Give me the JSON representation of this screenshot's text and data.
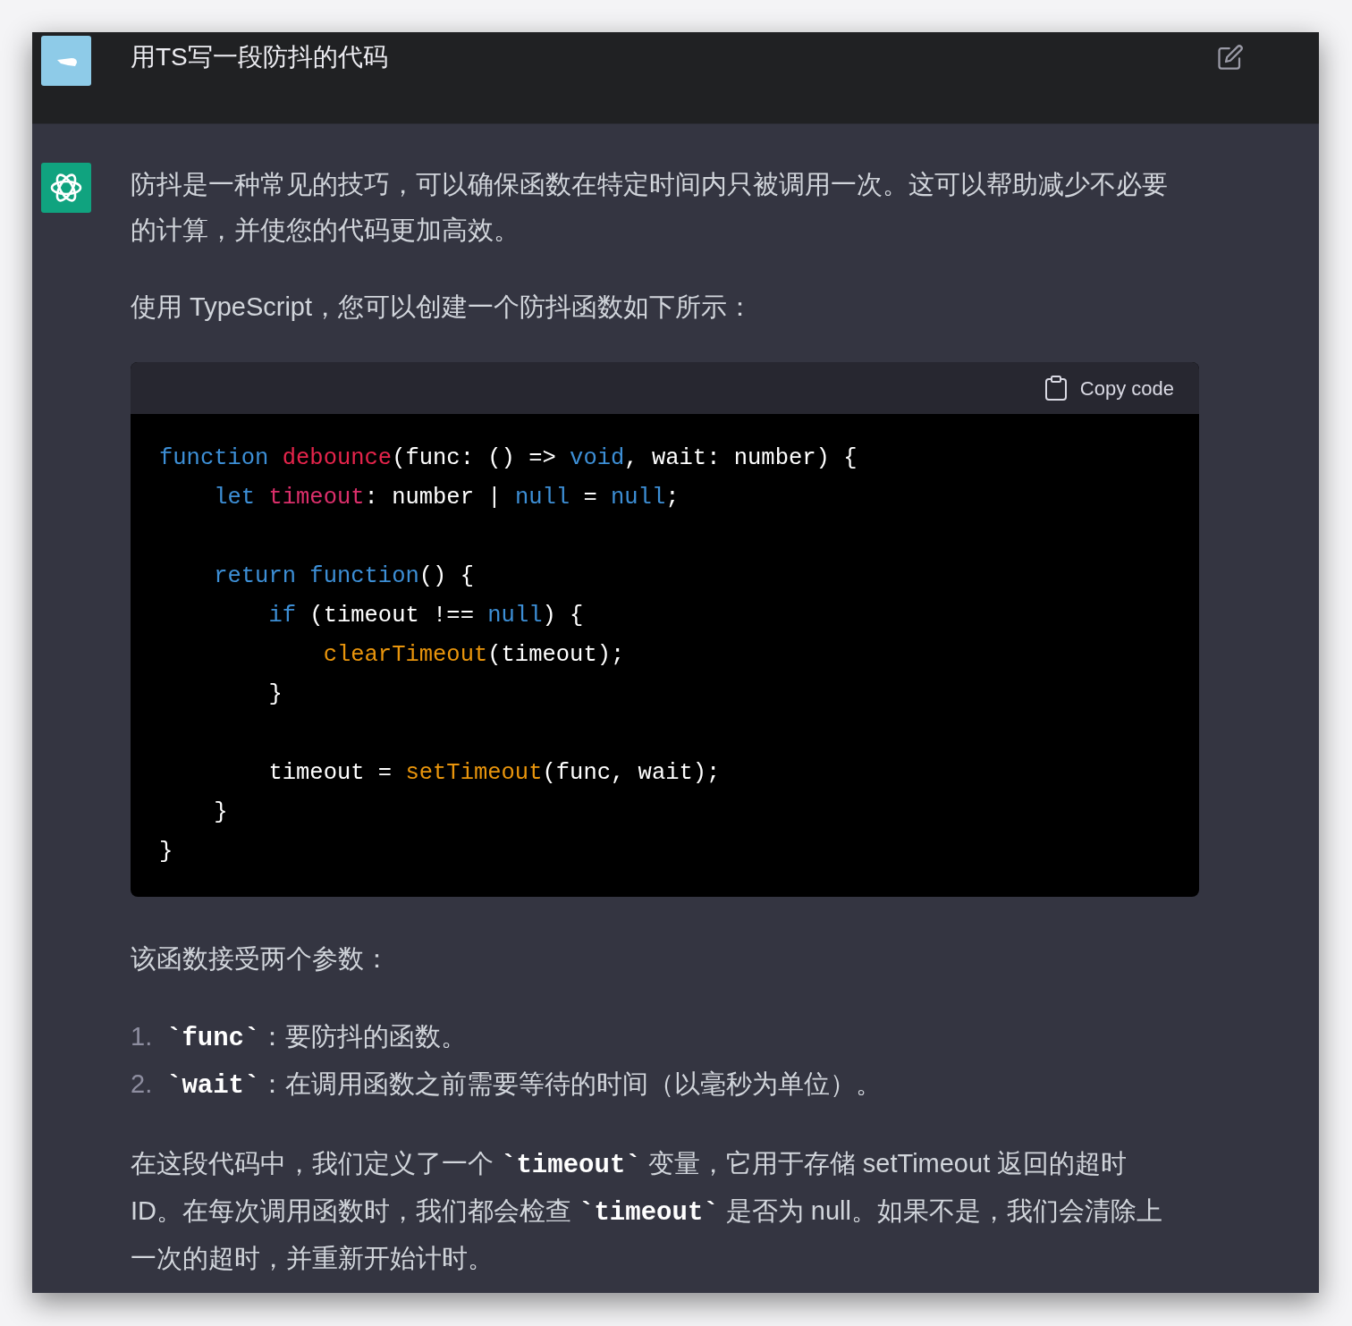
{
  "question": {
    "text": "用TS写一段防抖的代码"
  },
  "answer": {
    "intro": [
      {
        "segments": [
          {
            "kind": "text",
            "text": "防抖是一种常见的技巧，可以确保函数在特定时间内只被调用一次。这可以帮助减少不必要的计算，并使您的代码更加高效。"
          }
        ]
      },
      {
        "segments": [
          {
            "kind": "text",
            "text": "使用 TypeScript，您可以创建一个防抖函数如下所示："
          }
        ]
      }
    ],
    "code_block": {
      "copy_label": "Copy code",
      "lines": [
        {
          "kind": "code",
          "tokens": [
            {
              "kind": "keyword",
              "text": "function "
            },
            {
              "kind": "name",
              "text": "debounce"
            },
            {
              "kind": "plain",
              "text": "(func: () => "
            },
            {
              "kind": "keyword",
              "text": "void"
            },
            {
              "kind": "plain",
              "text": ", wait: number) {"
            }
          ]
        },
        {
          "kind": "code",
          "tokens": [
            {
              "kind": "keyword",
              "text": "    let "
            },
            {
              "kind": "variable",
              "text": "timeout"
            },
            {
              "kind": "plain",
              "text": ": number | "
            },
            {
              "kind": "keyword",
              "text": "null"
            },
            {
              "kind": "plain",
              "text": " = "
            },
            {
              "kind": "keyword",
              "text": "null"
            },
            {
              "kind": "plain",
              "text": ";"
            }
          ]
        },
        {
          "kind": "blank"
        },
        {
          "kind": "code",
          "tokens": [
            {
              "kind": "keyword",
              "text": "    return function"
            },
            {
              "kind": "plain",
              "text": "() {"
            }
          ]
        },
        {
          "kind": "code",
          "tokens": [
            {
              "kind": "keyword",
              "text": "        if"
            },
            {
              "kind": "plain",
              "text": " (timeout !== "
            },
            {
              "kind": "keyword",
              "text": "null"
            },
            {
              "kind": "plain",
              "text": ") {"
            }
          ]
        },
        {
          "kind": "code",
          "tokens": [
            {
              "kind": "builtin",
              "text": "            clearTimeout"
            },
            {
              "kind": "plain",
              "text": "(timeout);"
            }
          ]
        },
        {
          "kind": "code",
          "tokens": [
            {
              "kind": "plain",
              "text": "        }"
            }
          ]
        },
        {
          "kind": "blank"
        },
        {
          "kind": "code",
          "tokens": [
            {
              "kind": "plain",
              "text": "        timeout = "
            },
            {
              "kind": "builtin",
              "text": "setTimeout"
            },
            {
              "kind": "plain",
              "text": "(func, wait);"
            }
          ]
        },
        {
          "kind": "code",
          "tokens": [
            {
              "kind": "plain",
              "text": "    }"
            }
          ]
        },
        {
          "kind": "code",
          "tokens": [
            {
              "kind": "plain",
              "text": "}"
            }
          ]
        }
      ]
    },
    "params_intro": {
      "segments": [
        {
          "kind": "text",
          "text": "该函数接受两个参数："
        }
      ]
    },
    "params": [
      {
        "number": "1.",
        "segments": [
          {
            "kind": "code",
            "text": "`func`"
          },
          {
            "kind": "text",
            "text": "：要防抖的函数。"
          }
        ]
      },
      {
        "number": "2.",
        "segments": [
          {
            "kind": "code",
            "text": "`wait`"
          },
          {
            "kind": "text",
            "text": "：在调用函数之前需要等待的时间（以毫秒为单位）。"
          }
        ]
      }
    ],
    "explanation": {
      "segments": [
        {
          "kind": "text",
          "text": "在这段代码中，我们定义了一个 "
        },
        {
          "kind": "code",
          "text": "`timeout`"
        },
        {
          "kind": "text",
          "text": " 变量，它用于存储 setTimeout 返回的超时 ID。在每次调用函数时，我们都会检查 "
        },
        {
          "kind": "code",
          "text": "`timeout`"
        },
        {
          "kind": "text",
          "text": " 是否为 null。如果不是，我们会清除上一次的超时，并重新开始计时。"
        }
      ]
    }
  }
}
